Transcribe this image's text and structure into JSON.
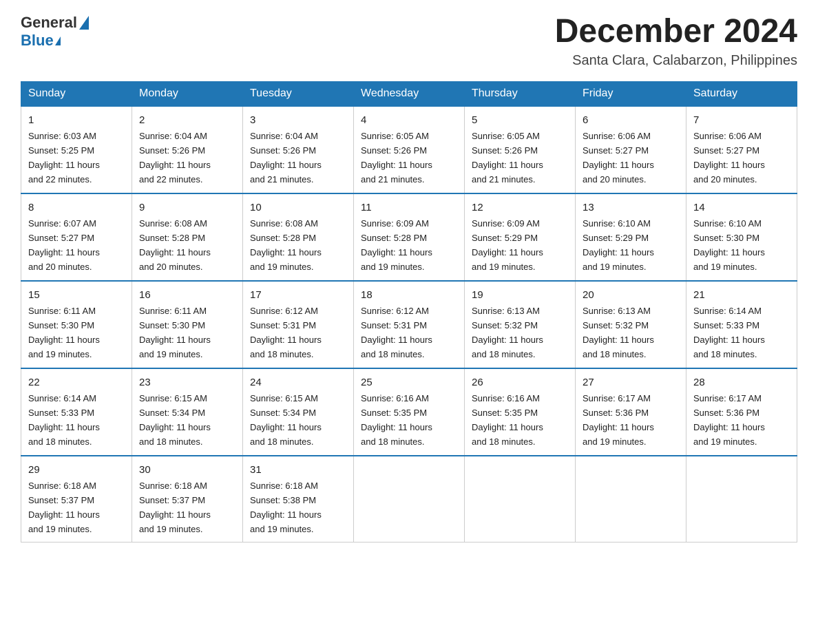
{
  "header": {
    "logo_general": "General",
    "logo_blue": "Blue",
    "month_title": "December 2024",
    "location": "Santa Clara, Calabarzon, Philippines"
  },
  "weekdays": [
    "Sunday",
    "Monday",
    "Tuesday",
    "Wednesday",
    "Thursday",
    "Friday",
    "Saturday"
  ],
  "weeks": [
    [
      {
        "day": "1",
        "sunrise": "6:03 AM",
        "sunset": "5:25 PM",
        "daylight": "11 hours and 22 minutes."
      },
      {
        "day": "2",
        "sunrise": "6:04 AM",
        "sunset": "5:26 PM",
        "daylight": "11 hours and 22 minutes."
      },
      {
        "day": "3",
        "sunrise": "6:04 AM",
        "sunset": "5:26 PM",
        "daylight": "11 hours and 21 minutes."
      },
      {
        "day": "4",
        "sunrise": "6:05 AM",
        "sunset": "5:26 PM",
        "daylight": "11 hours and 21 minutes."
      },
      {
        "day": "5",
        "sunrise": "6:05 AM",
        "sunset": "5:26 PM",
        "daylight": "11 hours and 21 minutes."
      },
      {
        "day": "6",
        "sunrise": "6:06 AM",
        "sunset": "5:27 PM",
        "daylight": "11 hours and 20 minutes."
      },
      {
        "day": "7",
        "sunrise": "6:06 AM",
        "sunset": "5:27 PM",
        "daylight": "11 hours and 20 minutes."
      }
    ],
    [
      {
        "day": "8",
        "sunrise": "6:07 AM",
        "sunset": "5:27 PM",
        "daylight": "11 hours and 20 minutes."
      },
      {
        "day": "9",
        "sunrise": "6:08 AM",
        "sunset": "5:28 PM",
        "daylight": "11 hours and 20 minutes."
      },
      {
        "day": "10",
        "sunrise": "6:08 AM",
        "sunset": "5:28 PM",
        "daylight": "11 hours and 19 minutes."
      },
      {
        "day": "11",
        "sunrise": "6:09 AM",
        "sunset": "5:28 PM",
        "daylight": "11 hours and 19 minutes."
      },
      {
        "day": "12",
        "sunrise": "6:09 AM",
        "sunset": "5:29 PM",
        "daylight": "11 hours and 19 minutes."
      },
      {
        "day": "13",
        "sunrise": "6:10 AM",
        "sunset": "5:29 PM",
        "daylight": "11 hours and 19 minutes."
      },
      {
        "day": "14",
        "sunrise": "6:10 AM",
        "sunset": "5:30 PM",
        "daylight": "11 hours and 19 minutes."
      }
    ],
    [
      {
        "day": "15",
        "sunrise": "6:11 AM",
        "sunset": "5:30 PM",
        "daylight": "11 hours and 19 minutes."
      },
      {
        "day": "16",
        "sunrise": "6:11 AM",
        "sunset": "5:30 PM",
        "daylight": "11 hours and 19 minutes."
      },
      {
        "day": "17",
        "sunrise": "6:12 AM",
        "sunset": "5:31 PM",
        "daylight": "11 hours and 18 minutes."
      },
      {
        "day": "18",
        "sunrise": "6:12 AM",
        "sunset": "5:31 PM",
        "daylight": "11 hours and 18 minutes."
      },
      {
        "day": "19",
        "sunrise": "6:13 AM",
        "sunset": "5:32 PM",
        "daylight": "11 hours and 18 minutes."
      },
      {
        "day": "20",
        "sunrise": "6:13 AM",
        "sunset": "5:32 PM",
        "daylight": "11 hours and 18 minutes."
      },
      {
        "day": "21",
        "sunrise": "6:14 AM",
        "sunset": "5:33 PM",
        "daylight": "11 hours and 18 minutes."
      }
    ],
    [
      {
        "day": "22",
        "sunrise": "6:14 AM",
        "sunset": "5:33 PM",
        "daylight": "11 hours and 18 minutes."
      },
      {
        "day": "23",
        "sunrise": "6:15 AM",
        "sunset": "5:34 PM",
        "daylight": "11 hours and 18 minutes."
      },
      {
        "day": "24",
        "sunrise": "6:15 AM",
        "sunset": "5:34 PM",
        "daylight": "11 hours and 18 minutes."
      },
      {
        "day": "25",
        "sunrise": "6:16 AM",
        "sunset": "5:35 PM",
        "daylight": "11 hours and 18 minutes."
      },
      {
        "day": "26",
        "sunrise": "6:16 AM",
        "sunset": "5:35 PM",
        "daylight": "11 hours and 18 minutes."
      },
      {
        "day": "27",
        "sunrise": "6:17 AM",
        "sunset": "5:36 PM",
        "daylight": "11 hours and 19 minutes."
      },
      {
        "day": "28",
        "sunrise": "6:17 AM",
        "sunset": "5:36 PM",
        "daylight": "11 hours and 19 minutes."
      }
    ],
    [
      {
        "day": "29",
        "sunrise": "6:18 AM",
        "sunset": "5:37 PM",
        "daylight": "11 hours and 19 minutes."
      },
      {
        "day": "30",
        "sunrise": "6:18 AM",
        "sunset": "5:37 PM",
        "daylight": "11 hours and 19 minutes."
      },
      {
        "day": "31",
        "sunrise": "6:18 AM",
        "sunset": "5:38 PM",
        "daylight": "11 hours and 19 minutes."
      },
      null,
      null,
      null,
      null
    ]
  ],
  "labels": {
    "sunrise": "Sunrise:",
    "sunset": "Sunset:",
    "daylight": "Daylight:"
  }
}
